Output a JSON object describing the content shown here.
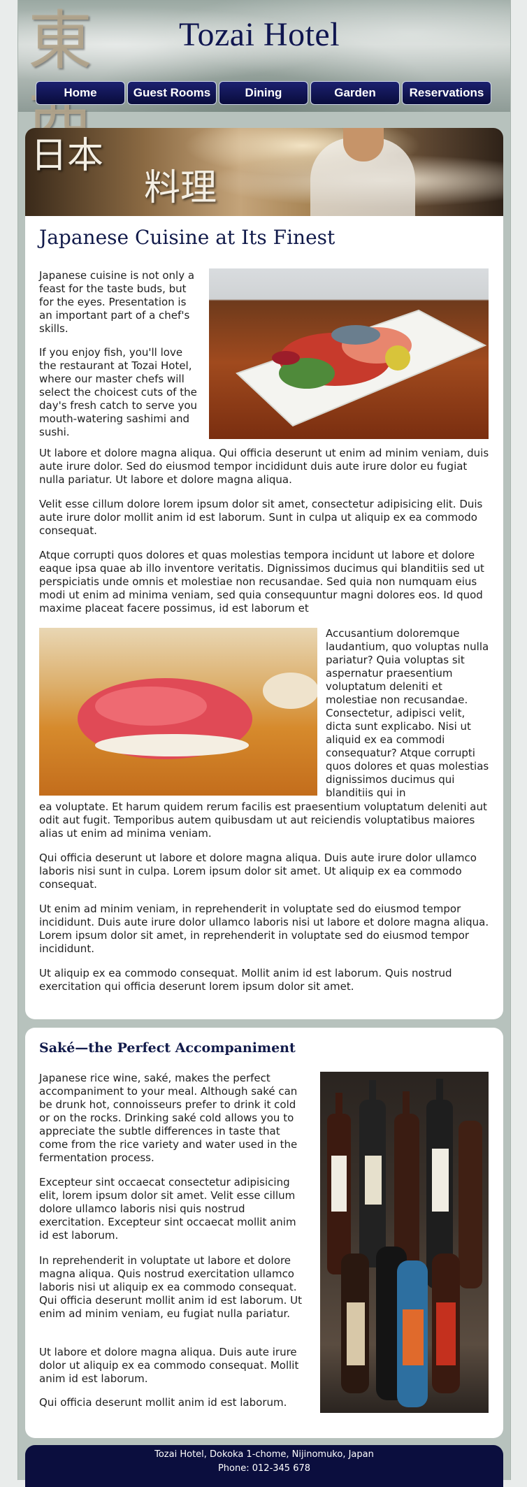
{
  "header": {
    "logo_kanji": "東 西",
    "title": "Tozai Hotel"
  },
  "nav": [
    {
      "label": "Home"
    },
    {
      "label": "Guest Rooms"
    },
    {
      "label": "Dining"
    },
    {
      "label": "Garden"
    },
    {
      "label": "Reservations"
    }
  ],
  "banner": {
    "kanji_top": "日本",
    "kanji_bottom": "料理"
  },
  "cuisine": {
    "heading": "Japanese Cuisine at Its Finest",
    "p1": "Japanese cuisine is not only a feast for the taste buds, but for the eyes. Presentation is an important part of a chef's skills.",
    "p2": "If you enjoy fish, you'll love the restaurant at Tozai Hotel, where our master chefs will select the choicest cuts of the day's fresh catch to serve you mouth-watering sashimi and sushi.",
    "p3": "Ut labore et dolore magna aliqua. Qui officia deserunt ut enim ad minim veniam, duis aute irure dolor. Sed do eiusmod tempor incididunt duis aute irure dolor eu fugiat nulla pariatur. Ut labore et dolore magna aliqua.",
    "p4": "Velit esse cillum dolore lorem ipsum dolor sit amet, consectetur adipisicing elit. Duis aute irure dolor mollit anim id est laborum. Sunt in culpa ut aliquip ex ea commodo consequat.",
    "p5": "Atque corrupti quos dolores et quas molestias tempora incidunt ut labore et dolore eaque ipsa quae ab illo inventore veritatis. Dignissimos ducimus qui blanditiis sed ut perspiciatis unde omnis et molestiae non recusandae. Sed quia non numquam eius modi ut enim ad minima veniam, sed quia consequuntur magni dolores eos. Id quod maxime placeat facere possimus, id est laborum et",
    "p5b": "Accusantium doloremque laudantium, quo voluptas nulla pariatur? Quia voluptas sit aspernatur praesentium voluptatum deleniti et molestiae non recusandae. Consectetur, adipisci velit, dicta sunt explicabo. Nisi ut aliquid ex ea commodi consequatur? Atque corrupti quos dolores et quas molestias dignissimos ducimus qui blanditiis qui in",
    "p5c": "ea voluptate. Et harum quidem rerum facilis est praesentium voluptatum deleniti aut odit aut fugit. Temporibus autem quibusdam ut aut reiciendis voluptatibus maiores alias ut enim ad minima veniam.",
    "p6": "Qui officia deserunt ut labore et dolore magna aliqua. Duis aute irure dolor ullamco laboris nisi sunt in culpa. Lorem ipsum dolor sit amet. Ut aliquip ex ea commodo consequat.",
    "p7": "Ut enim ad minim veniam, in reprehenderit in voluptate sed do eiusmod tempor incididunt. Duis aute irure dolor ullamco laboris nisi ut labore et dolore magna aliqua. Lorem ipsum dolor sit amet, in reprehenderit in voluptate sed do eiusmod tempor incididunt.",
    "p8": "Ut aliquip ex ea commodo consequat. Mollit anim id est laborum. Quis nostrud exercitation qui officia deserunt lorem ipsum dolor sit amet."
  },
  "sake": {
    "heading": "Saké—the Perfect Accompaniment",
    "p1": "Japanese rice wine, saké, makes the perfect accompaniment to your meal. Although saké can be drunk hot, connoisseurs prefer to drink it cold or on the rocks. Drinking saké cold allows you to appreciate the subtle differences in taste that come from the rice variety and water used in the fermentation process.",
    "p2": "Excepteur sint occaecat consectetur adipisicing elit, lorem ipsum dolor sit amet. Velit esse cillum dolore ullamco laboris nisi quis nostrud exercitation. Excepteur sint occaecat mollit anim id est laborum.",
    "p3": "In reprehenderit in voluptate ut labore et dolore magna aliqua. Quis nostrud exercitation ullamco laboris nisi ut aliquip ex ea commodo consequat. Qui officia deserunt mollit anim id est laborum. Ut enim ad minim veniam, eu fugiat nulla pariatur.",
    "p4": "Ut labore et dolore magna aliqua. Duis aute irure dolor ut aliquip ex ea commodo consequat. Mollit anim id est laborum.",
    "p5": "Qui officia deserunt mollit anim id est laborum."
  },
  "footer": {
    "address": "Tozai Hotel, Dokoka 1-chome, Nijinomuko, Japan",
    "phone": "Phone: 012-345 678"
  },
  "colors": {
    "nav_bg": "#0b0e3e",
    "heading": "#111a4a",
    "page_bg": "#b7c2bd"
  }
}
